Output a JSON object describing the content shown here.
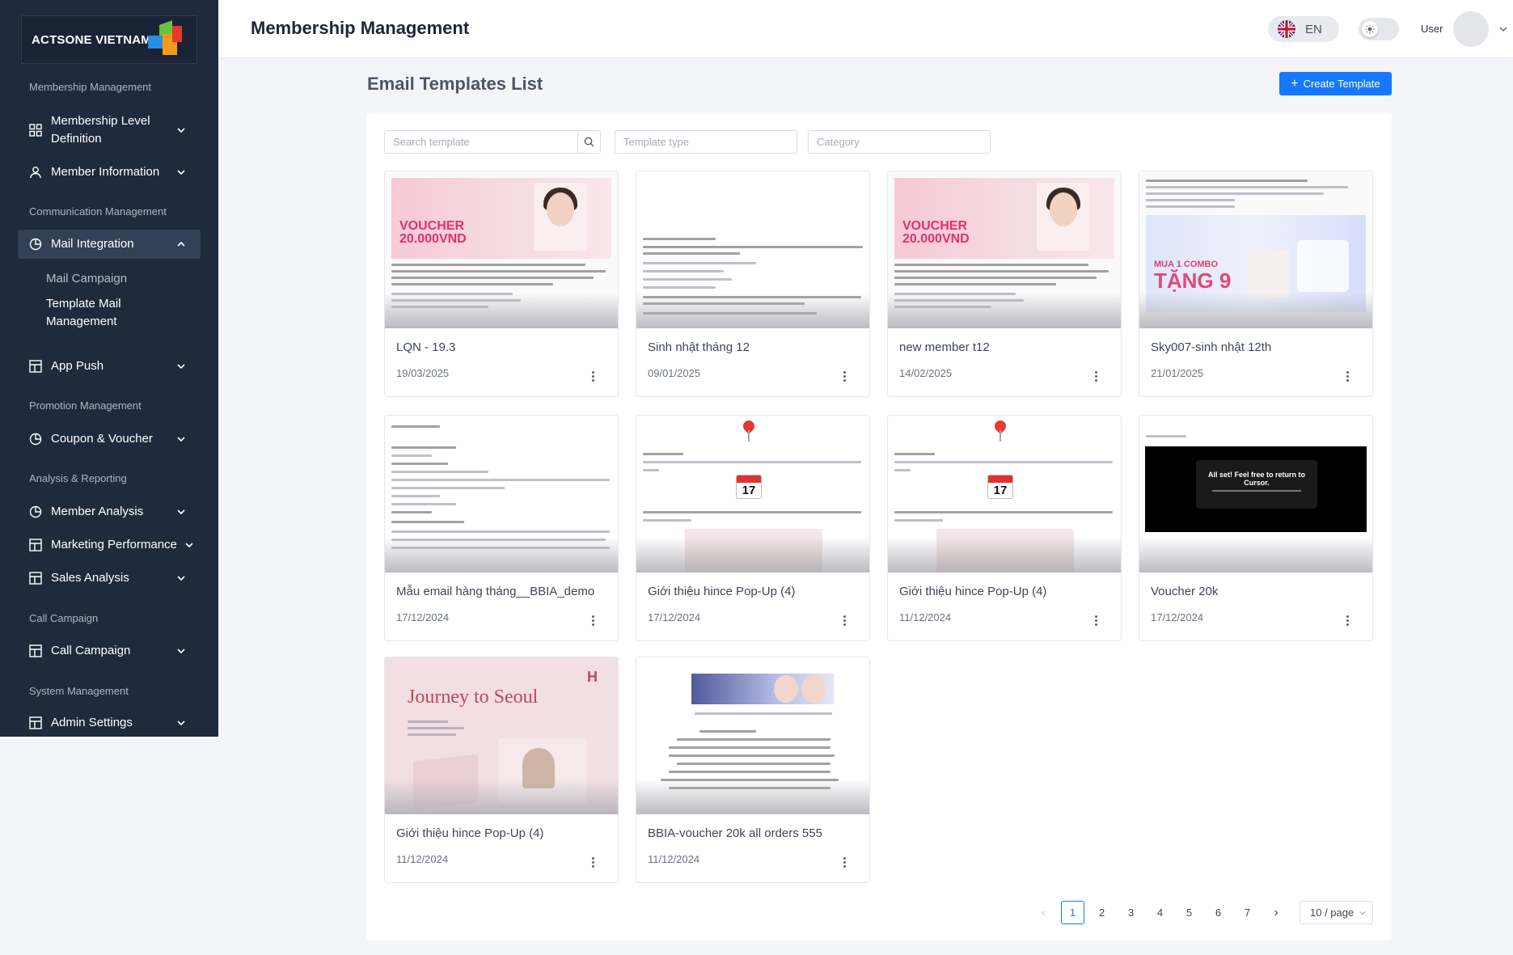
{
  "brand": {
    "name": "ACTSONE VIETNAM"
  },
  "header": {
    "title": "Membership Management",
    "language": "EN",
    "user_label": "User"
  },
  "sidebar": {
    "sections": [
      {
        "label": "Membership Management"
      },
      {
        "label": "Communication Management"
      },
      {
        "label": "Promotion Management"
      },
      {
        "label": "Analysis & Reporting"
      },
      {
        "label": "Call Campaign"
      },
      {
        "label": "System Management"
      }
    ],
    "items": [
      {
        "label": "Membership Level Definition",
        "icon": "grid-icon"
      },
      {
        "label": "Member Information",
        "icon": "user-icon"
      },
      {
        "label": "Mail Integration",
        "icon": "pie-chart-icon",
        "expanded": true
      },
      {
        "label": "App Push",
        "icon": "layout-icon"
      },
      {
        "label": "Coupon & Voucher",
        "icon": "pie-chart-icon"
      },
      {
        "label": "Member Analysis",
        "icon": "pie-chart-icon"
      },
      {
        "label": "Marketing Performance",
        "icon": "layout-icon"
      },
      {
        "label": "Sales Analysis",
        "icon": "layout-icon"
      },
      {
        "label": "Call Campaign",
        "icon": "layout-icon"
      },
      {
        "label": "Admin Settings",
        "icon": "layout-icon"
      }
    ],
    "subitems": [
      {
        "label": "Mail Campaign"
      },
      {
        "label": "Template Mail Management",
        "active": true
      }
    ]
  },
  "main": {
    "title": "Email Templates List",
    "create_label": "Create Template",
    "filters": {
      "search_placeholder": "Search template",
      "type_placeholder": "Template type",
      "category_placeholder": "Category"
    },
    "cards": [
      {
        "name": "LQN - 19.3",
        "date": "19/03/2025",
        "thumb_text": [
          "VOUCHER",
          "20.000VND"
        ]
      },
      {
        "name": "Sinh nhật tháng 12",
        "date": "09/01/2025"
      },
      {
        "name": "new member t12",
        "date": "14/02/2025",
        "thumb_text": [
          "VOUCHER",
          "20.000VND"
        ]
      },
      {
        "name": "Sky007-sinh nhật 12th",
        "date": "21/01/2025",
        "thumb_text": [
          "MUA 1 COMBO",
          "TẶNG 9"
        ]
      },
      {
        "name": "Mẫu email hàng tháng__BBIA_demo",
        "date": "17/12/2024"
      },
      {
        "name": "Giới thiệu hince Pop-Up (4)",
        "date": "17/12/2024",
        "thumb_text": [
          "17"
        ]
      },
      {
        "name": "Giới thiệu hince Pop-Up (4)",
        "date": "11/12/2024",
        "thumb_text": [
          "17"
        ]
      },
      {
        "name": "Voucher 20k",
        "date": "17/12/2024",
        "thumb_text": [
          "All set! Feel free to return to Cursor."
        ]
      },
      {
        "name": "Giới thiệu hince Pop-Up (4)",
        "date": "11/12/2024",
        "thumb_text": [
          "Journey to Seoul"
        ]
      },
      {
        "name": "BBIA-voucher 20k all orders 555",
        "date": "11/12/2024"
      }
    ]
  },
  "pagination": {
    "pages": [
      "1",
      "2",
      "3",
      "4",
      "5",
      "6",
      "7"
    ],
    "current": "1",
    "page_size": "10 / page"
  },
  "colors": {
    "sidebar": "#1f2a3c",
    "primary": "#1677ff",
    "background": "#f4f5f8"
  }
}
